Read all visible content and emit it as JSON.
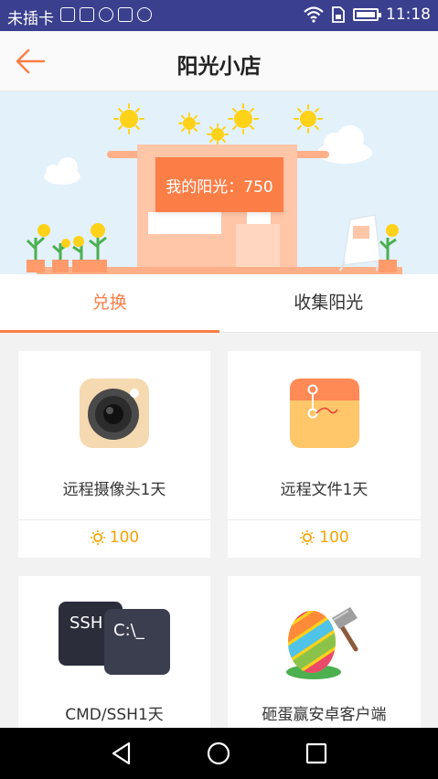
{
  "status_bar": {
    "carrier": "未插卡",
    "time": "11:18"
  },
  "header": {
    "title": "阳光小店",
    "back_icon": "arrow-left-icon"
  },
  "banner": {
    "sunshine_label": "我的阳光：750"
  },
  "tabs": [
    {
      "label": "兑换",
      "active": true
    },
    {
      "label": "收集阳光",
      "active": false
    }
  ],
  "products": [
    {
      "name": "远程摄像头1天",
      "price": "100",
      "icon": "camera-icon"
    },
    {
      "name": "远程文件1天",
      "price": "100",
      "icon": "folder-icon"
    },
    {
      "name": "CMD/SSH1天",
      "price": "",
      "icon": "terminal-icon",
      "icon_text_a": "SSH",
      "icon_text_b": "C:\\_"
    },
    {
      "name": "砸蛋赢安卓客户端",
      "price": "",
      "icon": "egg-hammer-icon"
    }
  ],
  "colors": {
    "accent": "#fb7e47",
    "sun": "#f5a300",
    "status_bar": "#3a3f8e"
  }
}
